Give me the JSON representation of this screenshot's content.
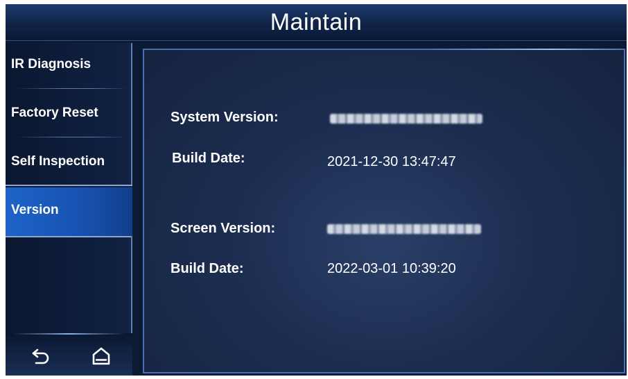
{
  "title": "Maintain",
  "sidebar": {
    "items": [
      {
        "label": "IR Diagnosis"
      },
      {
        "label": "Factory Reset"
      },
      {
        "label": "Self Inspection"
      },
      {
        "label": "Version",
        "active": true
      }
    ],
    "bottom_icons": [
      "back-arrow-icon",
      "home-icon"
    ]
  },
  "content": {
    "system_version_label": "System Version:",
    "system_version_value": "",
    "system_build_label": "Build Date:",
    "system_build_value": "2021-12-30 13:47:47",
    "screen_version_label": "Screen Version:",
    "screen_version_value": "",
    "screen_build_label": "Build Date:",
    "screen_build_value": "2022-03-01 10:39:20"
  },
  "colors": {
    "active_item": "#1e63c8",
    "frame_border": "#4a6fb5",
    "background": "#0d1a33"
  }
}
